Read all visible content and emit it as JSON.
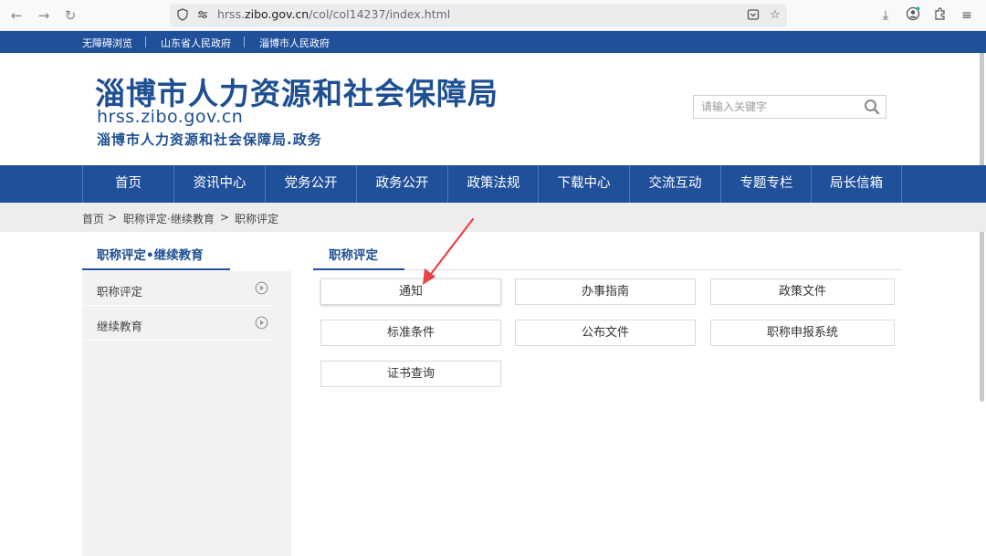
{
  "browser": {
    "url_prefix": "hrss.",
    "url_domain": "zibo.gov.cn",
    "url_path": "/col/col14237/index.html",
    "icons": [
      "back-icon",
      "forward-icon",
      "reload-icon",
      "shield-icon",
      "site-info-icon",
      "save-to-pocket-icon",
      "bookmark-star-icon",
      "downloads-icon",
      "account-icon",
      "extensions-icon",
      "menu-icon"
    ]
  },
  "utility": {
    "links": [
      "无障碍浏览",
      "山东省人民政府",
      "淄博市人民政府"
    ]
  },
  "header": {
    "title": "淄博市人力资源和社会保障局",
    "domain": "hrss.zibo.gov.cn",
    "subtitle": "淄博市人力资源和社会保障局.政务",
    "search_placeholder": "请输入关键字"
  },
  "nav": {
    "items": [
      "首页",
      "资讯中心",
      "党务公开",
      "政务公开",
      "政策法规",
      "下载中心",
      "交流互动",
      "专题专栏",
      "局长信箱"
    ]
  },
  "breadcrumb": {
    "home": "首页",
    "sep1": ">",
    "level1": "职称评定·继续教育",
    "sep2": ">",
    "current": "职称评定"
  },
  "sidebar": {
    "title": "职称评定•继续教育",
    "items": [
      "职称评定",
      "继续教育"
    ]
  },
  "content": {
    "title": "职称评定",
    "tiles": [
      "通知",
      "办事指南",
      "政策文件",
      "标准条件",
      "公布文件",
      "职称申报系统",
      "证书查询"
    ]
  },
  "colors": {
    "brand_blue": "#21509b",
    "annotation_red": "#e84444"
  }
}
